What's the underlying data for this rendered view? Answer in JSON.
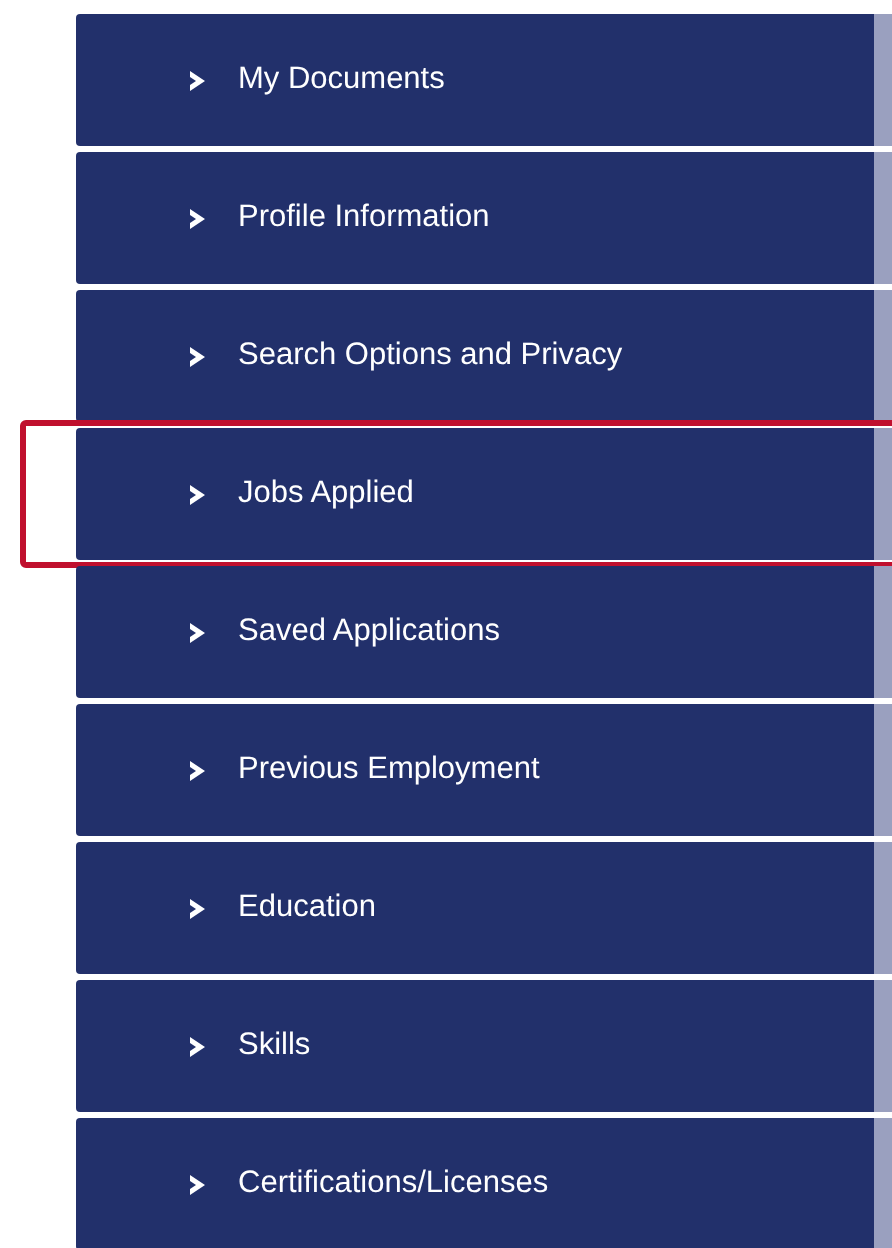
{
  "menu": {
    "items": [
      {
        "label": "My Documents",
        "highlighted": false
      },
      {
        "label": "Profile Information",
        "highlighted": false
      },
      {
        "label": "Search Options and Privacy",
        "highlighted": false
      },
      {
        "label": "Jobs Applied",
        "highlighted": true
      },
      {
        "label": "Saved Applications",
        "highlighted": false
      },
      {
        "label": "Previous Employment",
        "highlighted": false
      },
      {
        "label": "Education",
        "highlighted": false
      },
      {
        "label": "Skills",
        "highlighted": false
      },
      {
        "label": "Certifications/Licenses",
        "highlighted": false
      }
    ]
  }
}
